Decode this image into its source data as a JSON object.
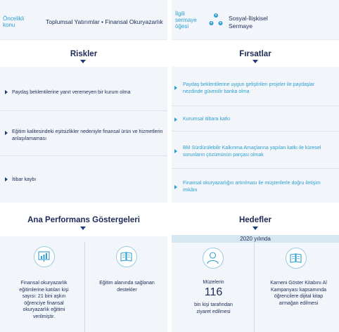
{
  "left": {
    "header": {
      "key": "Öncelikli konu",
      "value": "Toplumsal Yatırımlar • Finansal Okuryazarlık"
    },
    "risks": {
      "title": "Riskler",
      "items": [
        "Paydaş beklentilerine yanıt veremeyen bir kurum olma",
        "Eğitim kalitesindeki eşitsizlikler nedeniyle finansal ürün ve hizmetlerin anlaşılamaması",
        "İtibar kaybı"
      ]
    },
    "kpi": {
      "title": "Ana Performans Göstergeleri",
      "cells": [
        {
          "text": "Finansal okuryazarlık eğitimlerine katılan kişi sayısı: 21 bini aşkın öğrenciye finansal okuryazarlık eğitimi verilmiştir."
        },
        {
          "text": "Eğitim alanında sağlanan destekler"
        }
      ]
    }
  },
  "right": {
    "header": {
      "key": "İlgili sermaye öğesi",
      "value": "Sosyal-İlişkisel Sermaye"
    },
    "opportunities": {
      "title": "Fırsatlar",
      "items": [
        "Paydaş beklentilerine uygun geliştirilen projeler ile paydaşlar nezdinde güvenilir banka olma",
        "Kurumsal itibara katkı",
        "BM Sürdürülebilir Kalkınma Amaçlarına yapılan katkı ile küresel sorunların çözümünün parçası olmak",
        "Finansal okuryazarlığın artırılması ile müşterilerle doğru iletişim imkânı"
      ]
    },
    "goals": {
      "title": "Hedefler",
      "year": "2020 yılında",
      "cells": [
        {
          "pre": "Müzelerin",
          "number": "116",
          "post": "bin kişi tarafından ziyaret edilmesi"
        },
        {
          "text": "Karneni Göster Kitabını Al Kampanyası kapsamında öğrencilere dijital kitap armağan edilmesi"
        }
      ]
    }
  },
  "colors": {
    "navy": "#1d2a57",
    "accent": "#2e9fd0",
    "panel": "#f2f6fa",
    "divider": "#d9e6f0"
  }
}
